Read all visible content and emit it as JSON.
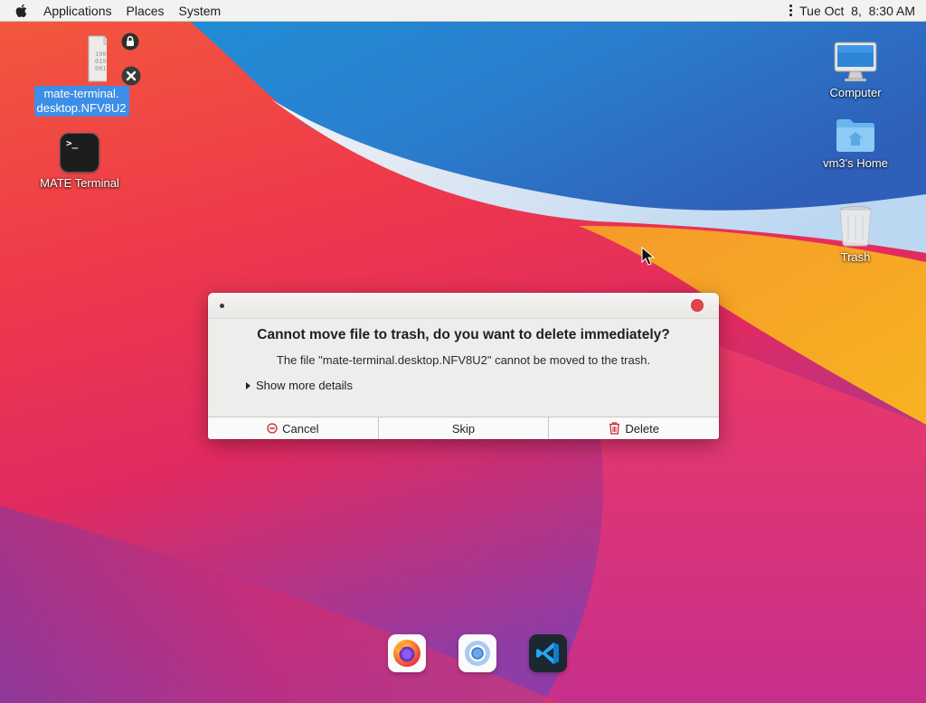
{
  "panel": {
    "menus": [
      "Applications",
      "Places",
      "System"
    ],
    "clock": "Tue Oct  8,  8:30 AM"
  },
  "desktop": {
    "file": {
      "label_line1": "mate-terminal.",
      "label_line2": "desktop.NFV8U2",
      "icon": "binary-file-icon",
      "glyph_text": "1000\n0100\n0010"
    },
    "terminal": {
      "label": "MATE Terminal",
      "icon": "terminal-icon",
      "prompt": ">_"
    },
    "computer": {
      "label": "Computer",
      "icon": "computer-icon"
    },
    "home": {
      "label": "vm3's Home",
      "icon": "home-folder-icon"
    },
    "trash": {
      "label": "Trash",
      "icon": "trash-icon"
    }
  },
  "dialog": {
    "heading": "Cannot move file to trash, do you want to delete immediately?",
    "message": "The file \"mate-terminal.desktop.NFV8U2\" cannot be moved to the trash.",
    "details_label": "Show more details",
    "buttons": {
      "cancel": "Cancel",
      "skip": "Skip",
      "delete": "Delete"
    }
  },
  "dock": {
    "apps": [
      "firefox-icon",
      "chromium-icon",
      "vscode-icon"
    ]
  },
  "colors": {
    "selection": "#3d8ee6",
    "close_button": "#e5424d",
    "destructive": "#c0272d"
  }
}
